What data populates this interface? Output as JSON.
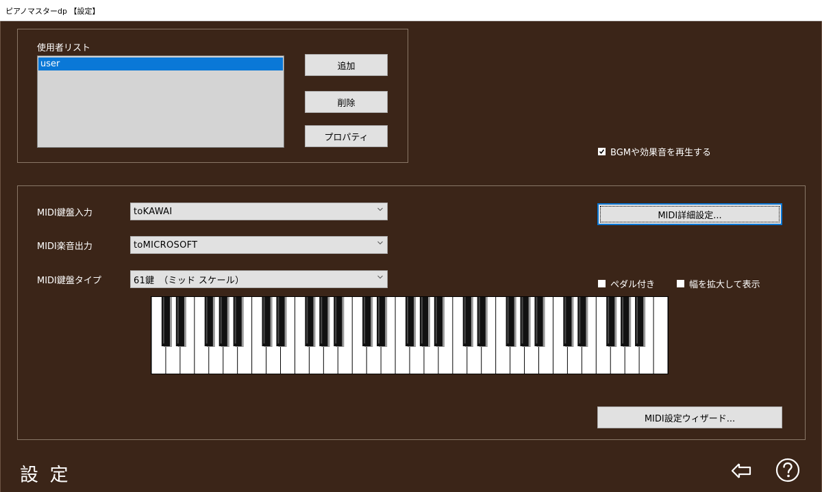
{
  "window": {
    "title": "ピアノマスターdp 【設定】"
  },
  "user_list": {
    "label": "使用者リスト",
    "items": [
      "user"
    ],
    "selected_index": 0,
    "buttons": {
      "add": "追加",
      "delete": "削除",
      "properties": "プロパティ"
    }
  },
  "options": {
    "bgm_label": "BGMや効果音を再生する",
    "bgm_checked": true
  },
  "midi": {
    "input_label": "MIDI鍵盤入力",
    "input_value": "toKAWAI",
    "output_label": "MIDI楽音出力",
    "output_value": "toMICROSOFT",
    "type_label": "MIDI鍵盤タイプ",
    "type_value": "61鍵　（ミッド スケール）",
    "detail_button": "MIDI詳細設定...",
    "wizard_button": "MIDI設定ウィザード...",
    "pedal_label": "ペダル付き",
    "pedal_checked": false,
    "wide_label": "幅を拡大して表示",
    "wide_checked": false,
    "keyboard": {
      "white_keys": 36,
      "black_keys": 25
    }
  },
  "footer": {
    "title": "設 定",
    "back_icon": "back-arrow-icon",
    "help_icon": "help-icon"
  },
  "colors": {
    "background": "#3b2518",
    "selection": "#0a78d7",
    "button": "#e1e1e1"
  }
}
